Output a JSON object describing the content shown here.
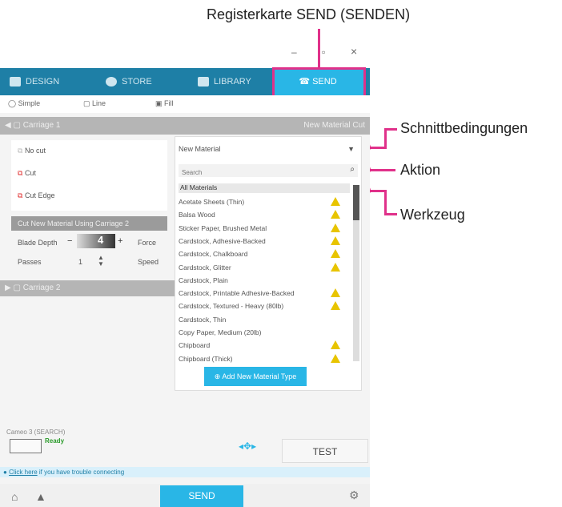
{
  "callouts": {
    "send_tab": "Registerkarte SEND (SENDEN)",
    "cut_conditions": "Schnittbedingungen",
    "action": "Aktion",
    "tool": "Werkzeug"
  },
  "window_controls": {
    "minimize": "–",
    "restore": "▫",
    "close": "×"
  },
  "nav": {
    "design": "DESIGN",
    "store": "STORE",
    "library": "LIBRARY",
    "send": "SEND"
  },
  "modes": {
    "simple": "Simple",
    "line": "Line",
    "fill": "Fill"
  },
  "carriage1": {
    "label": "Carriage 1",
    "right_label": "New Material Cut"
  },
  "actions": [
    "No cut",
    "Cut",
    "Cut Edge"
  ],
  "cut_new_material": "Cut New Material Using Carriage 2",
  "fields": {
    "blade_depth_label": "Blade Depth",
    "blade_depth_value": "4",
    "force_label": "Force",
    "passes_label": "Passes",
    "passes_value": "1",
    "speed_label": "Speed"
  },
  "carriage2": {
    "label": "Carriage 2"
  },
  "material": {
    "selected": "New Material",
    "search_placeholder": "Search",
    "header": "All Materials",
    "items": [
      {
        "name": "Acetate Sheets (Thin)",
        "warn": true
      },
      {
        "name": "Balsa Wood",
        "warn": true
      },
      {
        "name": "Sticker Paper, Brushed Metal",
        "warn": true
      },
      {
        "name": "Cardstock, Adhesive-Backed",
        "warn": true
      },
      {
        "name": "Cardstock, Chalkboard",
        "warn": true
      },
      {
        "name": "Cardstock, Glitter",
        "warn": true
      },
      {
        "name": "Cardstock, Plain",
        "warn": false
      },
      {
        "name": "Cardstock, Printable Adhesive-Backed",
        "warn": true
      },
      {
        "name": "Cardstock, Textured - Heavy (80lb)",
        "warn": true
      },
      {
        "name": "Cardstock, Thin",
        "warn": false
      },
      {
        "name": "Copy Paper, Medium (20lb)",
        "warn": false
      },
      {
        "name": "Chipboard",
        "warn": true
      },
      {
        "name": "Chipboard (Thick)",
        "warn": true
      }
    ],
    "add_button": "Add New Material Type"
  },
  "device": {
    "name": "Cameo 3 (SEARCH)",
    "status": "Ready"
  },
  "test_button": "TEST",
  "help_bar": {
    "link": "Click here",
    "text": "if you have trouble connecting"
  },
  "send_button": "SEND",
  "colors": {
    "accent": "#29b6e6",
    "nav": "#1e7fa6",
    "callout_pink": "#e0318a",
    "warning": "#e8c400"
  }
}
